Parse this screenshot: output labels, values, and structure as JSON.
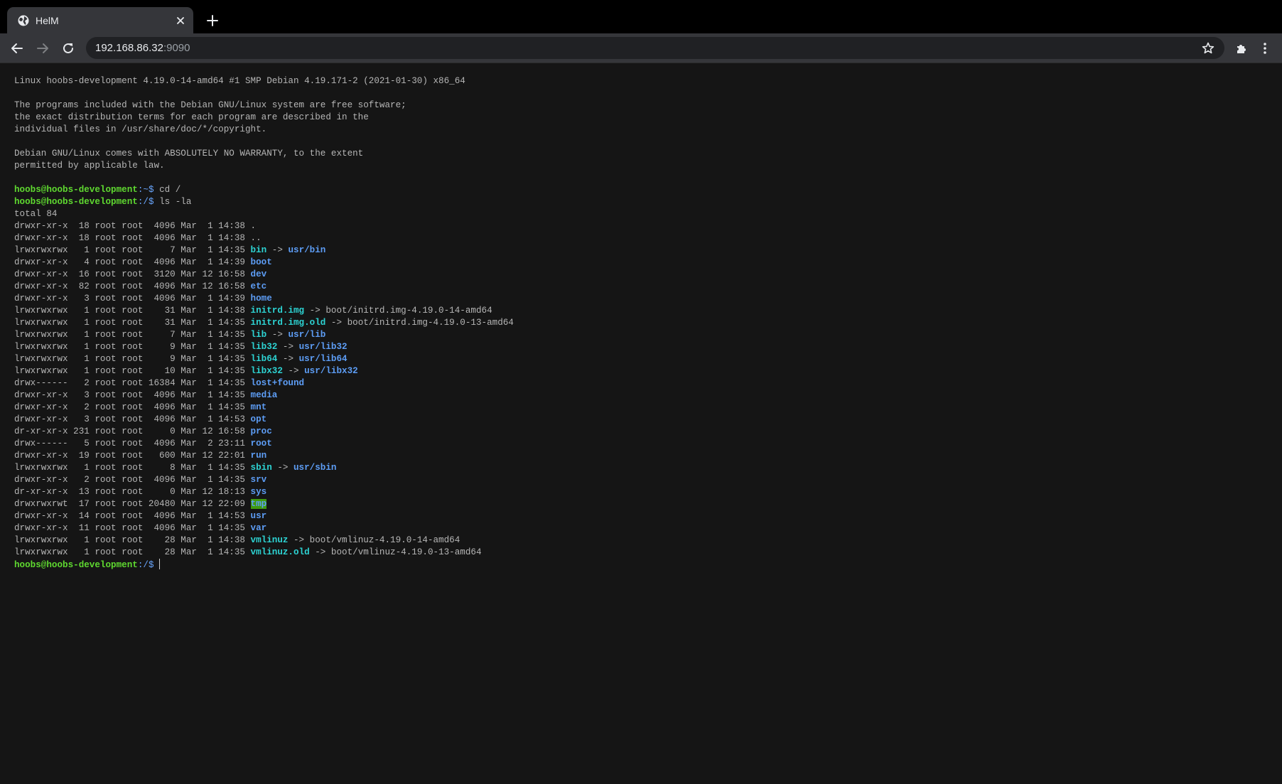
{
  "tab": {
    "title": "HelM"
  },
  "address_bar": {
    "host": "192.168.86.32",
    "port": ":9090"
  },
  "terminal": {
    "motd": [
      "Linux hoobs-development 4.19.0-14-amd64 #1 SMP Debian 4.19.171-2 (2021-01-30) x86_64",
      "",
      "The programs included with the Debian GNU/Linux system are free software;",
      "the exact distribution terms for each program are described in the",
      "individual files in /usr/share/doc/*/copyright.",
      "",
      "Debian GNU/Linux comes with ABSOLUTELY NO WARRANTY, to the extent",
      "permitted by applicable law.",
      ""
    ],
    "commands": [
      {
        "user_host": "hoobs@hoobs-development",
        "path": ":~$ ",
        "command": "cd /"
      },
      {
        "user_host": "hoobs@hoobs-development",
        "path": ":/$ ",
        "command": "ls -la"
      }
    ],
    "total": "total 84",
    "listing": [
      {
        "meta": "drwxr-xr-x  18 root root  4096 Mar  1 14:38 ",
        "name": ".",
        "type": "plain",
        "target": ""
      },
      {
        "meta": "drwxr-xr-x  18 root root  4096 Mar  1 14:38 ",
        "name": "..",
        "type": "plain",
        "target": ""
      },
      {
        "meta": "lrwxrwxrwx   1 root root     7 Mar  1 14:35 ",
        "name": "bin",
        "type": "link",
        "target": "usr/bin"
      },
      {
        "meta": "drwxr-xr-x   4 root root  4096 Mar  1 14:39 ",
        "name": "boot",
        "type": "dir",
        "target": ""
      },
      {
        "meta": "drwxr-xr-x  16 root root  3120 Mar 12 16:58 ",
        "name": "dev",
        "type": "dir",
        "target": ""
      },
      {
        "meta": "drwxr-xr-x  82 root root  4096 Mar 12 16:58 ",
        "name": "etc",
        "type": "dir",
        "target": ""
      },
      {
        "meta": "drwxr-xr-x   3 root root  4096 Mar  1 14:39 ",
        "name": "home",
        "type": "dir",
        "target": ""
      },
      {
        "meta": "lrwxrwxrwx   1 root root    31 Mar  1 14:38 ",
        "name": "initrd.img",
        "type": "link",
        "target": "boot/initrd.img-4.19.0-14-amd64",
        "target_plain": true
      },
      {
        "meta": "lrwxrwxrwx   1 root root    31 Mar  1 14:35 ",
        "name": "initrd.img.old",
        "type": "link",
        "target": "boot/initrd.img-4.19.0-13-amd64",
        "target_plain": true
      },
      {
        "meta": "lrwxrwxrwx   1 root root     7 Mar  1 14:35 ",
        "name": "lib",
        "type": "link",
        "target": "usr/lib"
      },
      {
        "meta": "lrwxrwxrwx   1 root root     9 Mar  1 14:35 ",
        "name": "lib32",
        "type": "link",
        "target": "usr/lib32"
      },
      {
        "meta": "lrwxrwxrwx   1 root root     9 Mar  1 14:35 ",
        "name": "lib64",
        "type": "link",
        "target": "usr/lib64"
      },
      {
        "meta": "lrwxrwxrwx   1 root root    10 Mar  1 14:35 ",
        "name": "libx32",
        "type": "link",
        "target": "usr/libx32"
      },
      {
        "meta": "drwx------   2 root root 16384 Mar  1 14:35 ",
        "name": "lost+found",
        "type": "dir",
        "target": ""
      },
      {
        "meta": "drwxr-xr-x   3 root root  4096 Mar  1 14:35 ",
        "name": "media",
        "type": "dir",
        "target": ""
      },
      {
        "meta": "drwxr-xr-x   2 root root  4096 Mar  1 14:35 ",
        "name": "mnt",
        "type": "dir",
        "target": ""
      },
      {
        "meta": "drwxr-xr-x   3 root root  4096 Mar  1 14:53 ",
        "name": "opt",
        "type": "dir",
        "target": ""
      },
      {
        "meta": "dr-xr-xr-x 231 root root     0 Mar 12 16:58 ",
        "name": "proc",
        "type": "dir",
        "target": ""
      },
      {
        "meta": "drwx------   5 root root  4096 Mar  2 23:11 ",
        "name": "root",
        "type": "dir",
        "target": ""
      },
      {
        "meta": "drwxr-xr-x  19 root root   600 Mar 12 22:01 ",
        "name": "run",
        "type": "dir",
        "target": ""
      },
      {
        "meta": "lrwxrwxrwx   1 root root     8 Mar  1 14:35 ",
        "name": "sbin",
        "type": "link",
        "target": "usr/sbin"
      },
      {
        "meta": "drwxr-xr-x   2 root root  4096 Mar  1 14:35 ",
        "name": "srv",
        "type": "dir",
        "target": ""
      },
      {
        "meta": "dr-xr-xr-x  13 root root     0 Mar 12 18:13 ",
        "name": "sys",
        "type": "dir",
        "target": ""
      },
      {
        "meta": "drwxrwxrwt  17 root root 20480 Mar 12 22:09 ",
        "name": "tmp",
        "type": "sticky",
        "target": ""
      },
      {
        "meta": "drwxr-xr-x  14 root root  4096 Mar  1 14:53 ",
        "name": "usr",
        "type": "dir",
        "target": ""
      },
      {
        "meta": "drwxr-xr-x  11 root root  4096 Mar  1 14:35 ",
        "name": "var",
        "type": "dir",
        "target": ""
      },
      {
        "meta": "lrwxrwxrwx   1 root root    28 Mar  1 14:38 ",
        "name": "vmlinuz",
        "type": "link",
        "target": "boot/vmlinuz-4.19.0-14-amd64",
        "target_plain": true
      },
      {
        "meta": "lrwxrwxrwx   1 root root    28 Mar  1 14:35 ",
        "name": "vmlinuz.old",
        "type": "link",
        "target": "boot/vmlinuz-4.19.0-13-amd64",
        "target_plain": true
      }
    ],
    "arrow": " -> ",
    "final_prompt": {
      "user_host": "hoobs@hoobs-development",
      "path": ":/$ "
    }
  },
  "colors": {
    "background": "#151515",
    "prompt": "#5fd930",
    "directory": "#5d9df5",
    "symlink": "#2dd3d3",
    "sticky_bg": "#3e9a0e"
  },
  "icons": {
    "favicon": "globe-icon",
    "close": "close-icon",
    "new_tab": "plus-icon",
    "back": "back-arrow-icon",
    "forward": "forward-arrow-icon",
    "reload": "reload-icon",
    "bookmark": "star-icon",
    "extensions": "puzzle-icon",
    "menu": "kebab-menu-icon"
  }
}
